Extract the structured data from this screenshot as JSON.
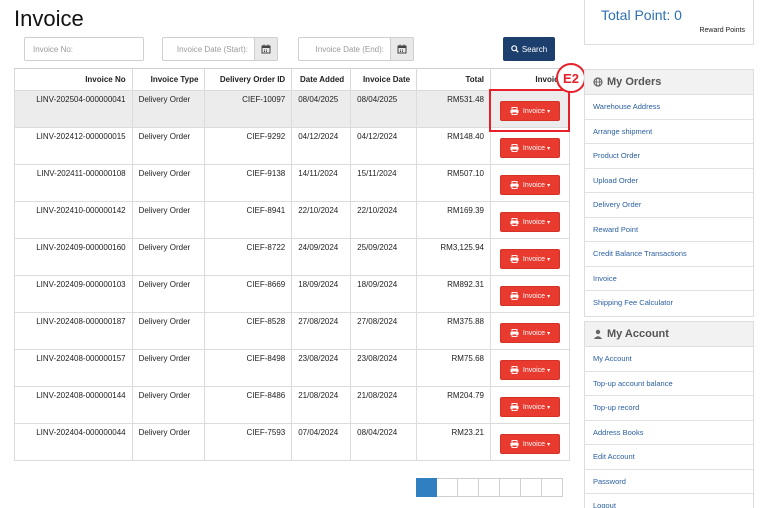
{
  "page": {
    "title": "Invoice"
  },
  "filters": {
    "invoice_no_placeholder": "Invoice No:",
    "date_start_placeholder": "Invoice Date (Start):",
    "date_end_placeholder": "Invoice Date (End):",
    "search_label": "Search"
  },
  "table": {
    "headers": [
      "Invoice No",
      "Invoice Type",
      "Delivery Order ID",
      "Date Added",
      "Invoice Date",
      "Total",
      "Invoice"
    ],
    "rows": [
      {
        "invoice_no": "LINV-202504-000000041",
        "type": "Delivery Order",
        "do_id": "CIEF-10097",
        "date_added": "08/04/2025",
        "invoice_date": "08/04/2025",
        "total": "RM531.48",
        "button": "Invoice"
      },
      {
        "invoice_no": "LINV-202412-000000015",
        "type": "Delivery Order",
        "do_id": "CIEF-9292",
        "date_added": "04/12/2024",
        "invoice_date": "04/12/2024",
        "total": "RM148.40",
        "button": "Invoice"
      },
      {
        "invoice_no": "LINV-202411-000000108",
        "type": "Delivery Order",
        "do_id": "CIEF-9138",
        "date_added": "14/11/2024",
        "invoice_date": "15/11/2024",
        "total": "RM507.10",
        "button": "Invoice"
      },
      {
        "invoice_no": "LINV-202410-000000142",
        "type": "Delivery Order",
        "do_id": "CIEF-8941",
        "date_added": "22/10/2024",
        "invoice_date": "22/10/2024",
        "total": "RM169.39",
        "button": "Invoice"
      },
      {
        "invoice_no": "LINV-202409-000000160",
        "type": "Delivery Order",
        "do_id": "CIEF-8722",
        "date_added": "24/09/2024",
        "invoice_date": "25/09/2024",
        "total": "RM3,125.94",
        "button": "Invoice"
      },
      {
        "invoice_no": "LINV-202409-000000103",
        "type": "Delivery Order",
        "do_id": "CIEF-8669",
        "date_added": "18/09/2024",
        "invoice_date": "18/09/2024",
        "total": "RM892.31",
        "button": "Invoice"
      },
      {
        "invoice_no": "LINV-202408-000000187",
        "type": "Delivery Order",
        "do_id": "CIEF-8528",
        "date_added": "27/08/2024",
        "invoice_date": "27/08/2024",
        "total": "RM375.88",
        "button": "Invoice"
      },
      {
        "invoice_no": "LINV-202408-000000157",
        "type": "Delivery Order",
        "do_id": "CIEF-8498",
        "date_added": "23/08/2024",
        "invoice_date": "23/08/2024",
        "total": "RM75.68",
        "button": "Invoice"
      },
      {
        "invoice_no": "LINV-202408-000000144",
        "type": "Delivery Order",
        "do_id": "CIEF-8486",
        "date_added": "21/08/2024",
        "invoice_date": "21/08/2024",
        "total": "RM204.79",
        "button": "Invoice"
      },
      {
        "invoice_no": "LINV-202404-000000044",
        "type": "Delivery Order",
        "do_id": "CIEF-7593",
        "date_added": "07/04/2024",
        "invoice_date": "08/04/2024",
        "total": "RM23.21",
        "button": "Invoice"
      }
    ]
  },
  "annotation": {
    "badge": "E2"
  },
  "points": {
    "title": "Total Point:  0",
    "subtitle": "Reward Points"
  },
  "orders_panel": {
    "title": "My Orders",
    "items": [
      "Warehouse Address",
      "Arrange shipment",
      "Product Order",
      "Upload Order",
      "Delivery Order",
      "Reward Point",
      "Credit Balance Transactions",
      "Invoice",
      "Shipping Fee Calculator"
    ]
  },
  "account_panel": {
    "title": "My Account",
    "items": [
      "My Account",
      "Top-up account balance",
      "Top-up record",
      "Address Books",
      "Edit Account",
      "Password",
      "Logout"
    ]
  },
  "colors": {
    "accent_red": "#e83a2e",
    "search_blue": "#1c3f6e",
    "link_blue": "#2a5fa0",
    "page_active": "#2f7fc1"
  }
}
